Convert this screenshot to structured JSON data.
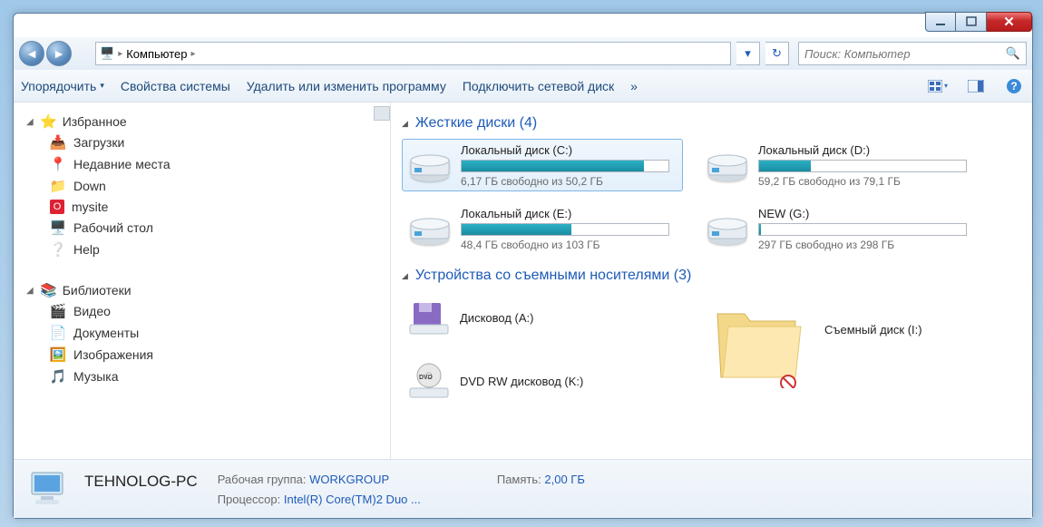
{
  "breadcrumb": {
    "location": "Компьютер"
  },
  "search": {
    "placeholder": "Поиск: Компьютер"
  },
  "toolbar": {
    "organize": "Упорядочить",
    "sysprops": "Свойства системы",
    "uninstall": "Удалить или изменить программу",
    "mapdrive": "Подключить сетевой диск",
    "overflow": "»"
  },
  "sidebar": {
    "favorites": {
      "title": "Избранное",
      "items": [
        "Загрузки",
        "Недавние места",
        "Down",
        "mysite",
        "Рабочий стол",
        "Help"
      ]
    },
    "libraries": {
      "title": "Библиотеки",
      "items": [
        "Видео",
        "Документы",
        "Изображения",
        "Музыка"
      ]
    }
  },
  "categories": {
    "hdd": {
      "title": "Жесткие диски (4)"
    },
    "removable": {
      "title": "Устройства со съемными носителями (3)"
    }
  },
  "drives": [
    {
      "name": "Локальный диск (C:)",
      "free": "6,17 ГБ свободно из 50,2 ГБ",
      "pct": 88,
      "sel": true
    },
    {
      "name": "Локальный диск (D:)",
      "free": "59,2 ГБ свободно из 79,1 ГБ",
      "pct": 25,
      "sel": false
    },
    {
      "name": "Локальный диск (E:)",
      "free": "48,4 ГБ свободно из 103 ГБ",
      "pct": 53,
      "sel": false
    },
    {
      "name": "NEW (G:)",
      "free": "297 ГБ свободно из 298 ГБ",
      "pct": 1,
      "sel": false
    }
  ],
  "removables": [
    {
      "name": "Дисковод (A:)",
      "type": "floppy"
    },
    {
      "name": "Съемный диск (I:)",
      "type": "folder"
    },
    {
      "name": "DVD RW дисковод (K:)",
      "type": "dvd"
    }
  ],
  "details": {
    "name": "TEHNOLOG-PC",
    "workgroup_label": "Рабочая группа:",
    "workgroup": "WORKGROUP",
    "cpu_label": "Процессор:",
    "cpu": "Intel(R) Core(TM)2 Duo ...",
    "mem_label": "Память:",
    "mem": "2,00 ГБ"
  }
}
